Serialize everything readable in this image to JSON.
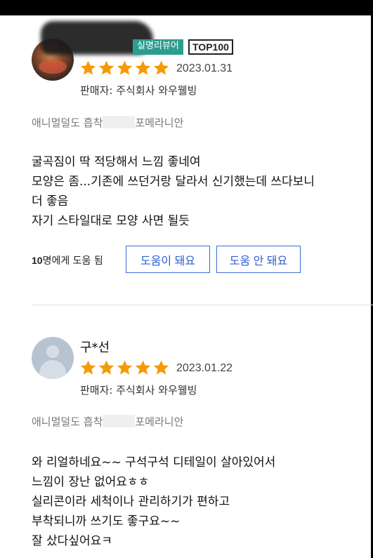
{
  "reviews": [
    {
      "badges": {
        "real_name": "실명리뷰어",
        "top": "TOP100"
      },
      "rating": 5,
      "date": "2023.01.31",
      "seller": "판매자: 주식회사 와우웰빙",
      "option_prefix": "애니멀덜도 흡착",
      "option_suffix": "포메라니안",
      "content": [
        "굴곡짐이 딱 적당해서 느낌 좋네여",
        "모양은 좀...기존에 쓰던거랑 달라서 신기했는데 쓰다보니",
        "더 좋음",
        "자기 스타일대로 모양 사면 될듯"
      ],
      "helpful_count": "10",
      "helpful_suffix": "명에게 도움 됨",
      "helpful_yes": "도움이 돼요",
      "helpful_no": "도움 안 돼요"
    },
    {
      "username": "구*선",
      "rating": 5,
      "date": "2023.01.22",
      "seller": "판매자: 주식회사 와우웰빙",
      "option_prefix": "애니멀덜도 흡착",
      "option_suffix": "포메라니안",
      "content": [
        "와 리얼하네요~~ 구석구석 디테일이 살아있어서",
        "느낌이 장난 없어요ㅎㅎ",
        "실리콘이라 세척이나 관리하기가 편하고",
        "부착되니까 쓰기도 좋구요~~",
        "잘 샀다싶어요ㅋ"
      ]
    }
  ],
  "colors": {
    "star": "#f59a06",
    "badge_real": "#2a9d8f",
    "button": "#3b6bd6"
  }
}
